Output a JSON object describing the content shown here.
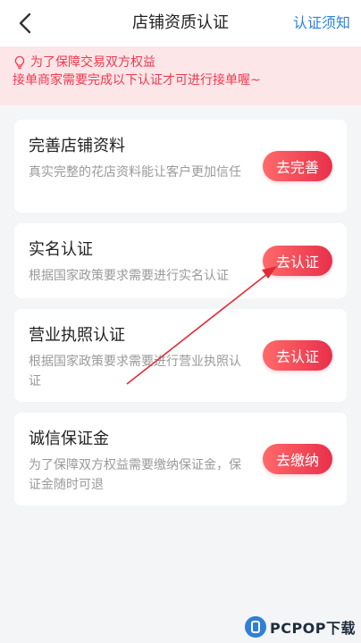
{
  "header": {
    "title": "店铺资质认证",
    "help_link": "认证须知",
    "back_icon": "chevron-left-icon"
  },
  "notice": {
    "line1": "为了保障交易双方权益",
    "line2": "接单商家需要完成以下认证才可进行接单喔~",
    "icon": "lightbulb-icon",
    "color": "#ee3a4f",
    "background": "#fde6e8"
  },
  "cards": [
    {
      "title": "完善店铺资料",
      "desc": "真实完整的花店资料能让客户更加信任",
      "button": "去完善"
    },
    {
      "title": "实名认证",
      "desc": "根据国家政策要求需要进行实名认证",
      "button": "去认证"
    },
    {
      "title": "营业执照认证",
      "desc": "根据国家政策要求需要进行营业执照认证",
      "button": "去认证"
    },
    {
      "title": "诚信保证金",
      "desc": "为了保障双方权益需要缴纳保证金，保证金随时可退",
      "button": "去缴纳"
    }
  ],
  "watermark": {
    "text": "PCPOP下载"
  },
  "colors": {
    "accent_red": "#e8304a",
    "link_blue": "#2a82e4",
    "page_bg": "#f4f5f7"
  }
}
